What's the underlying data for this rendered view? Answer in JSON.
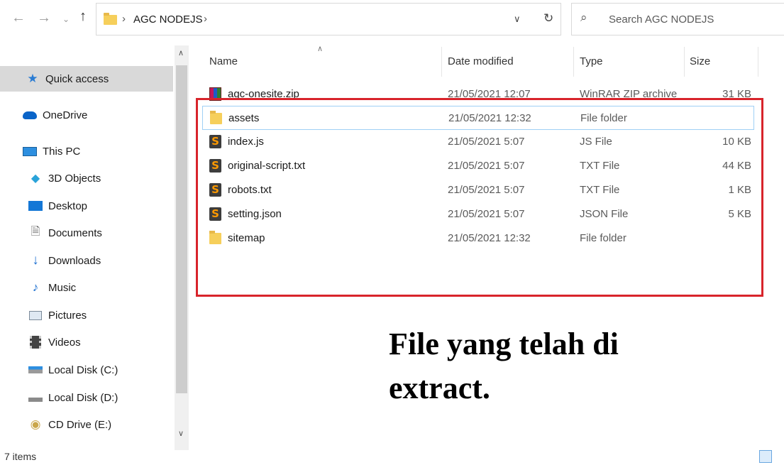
{
  "address_bar": {
    "path": [
      "AGC NODEJS"
    ],
    "search_placeholder": "Search AGC NODEJS"
  },
  "sidebar": {
    "items": [
      {
        "label": "Quick access",
        "icon": "star-icon",
        "selected": true
      },
      {
        "label": "OneDrive",
        "icon": "cloud-icon"
      },
      {
        "label": "This PC",
        "icon": "computer-icon"
      },
      {
        "label": "3D Objects",
        "icon": "cube-icon"
      },
      {
        "label": "Desktop",
        "icon": "desktop-icon"
      },
      {
        "label": "Documents",
        "icon": "document-icon"
      },
      {
        "label": "Downloads",
        "icon": "download-arrow-icon"
      },
      {
        "label": "Music",
        "icon": "music-note-icon"
      },
      {
        "label": "Pictures",
        "icon": "picture-icon"
      },
      {
        "label": "Videos",
        "icon": "film-icon"
      },
      {
        "label": "Local Disk (C:)",
        "icon": "windows-drive-icon"
      },
      {
        "label": "Local Disk (D:)",
        "icon": "drive-icon"
      },
      {
        "label": "CD Drive (E:)",
        "icon": "cd-icon"
      }
    ]
  },
  "columns": {
    "name": "Name",
    "date": "Date modified",
    "type": "Type",
    "size": "Size"
  },
  "files": [
    {
      "name": "agc-onesite.zip",
      "date": "21/05/2021 12:07",
      "type": "WinRAR ZIP archive",
      "size": "31 KB",
      "icon": "winrar-icon"
    },
    {
      "name": "assets",
      "date": "21/05/2021 12:32",
      "type": "File folder",
      "size": "",
      "icon": "folder-icon"
    },
    {
      "name": "index.js",
      "date": "21/05/2021 5:07",
      "type": "JS File",
      "size": "10 KB",
      "icon": "sublime-icon"
    },
    {
      "name": "original-script.txt",
      "date": "21/05/2021 5:07",
      "type": "TXT File",
      "size": "44 KB",
      "icon": "sublime-icon"
    },
    {
      "name": "robots.txt",
      "date": "21/05/2021 5:07",
      "type": "TXT File",
      "size": "1 KB",
      "icon": "sublime-icon"
    },
    {
      "name": "setting.json",
      "date": "21/05/2021 5:07",
      "type": "JSON File",
      "size": "5 KB",
      "icon": "sublime-icon"
    },
    {
      "name": "sitemap",
      "date": "21/05/2021 12:32",
      "type": "File folder",
      "size": "",
      "icon": "folder-icon"
    }
  ],
  "annotation": {
    "text": "File yang telah di extract.",
    "box_color": "#d8242b"
  },
  "status_bar": {
    "count": "7 items"
  }
}
